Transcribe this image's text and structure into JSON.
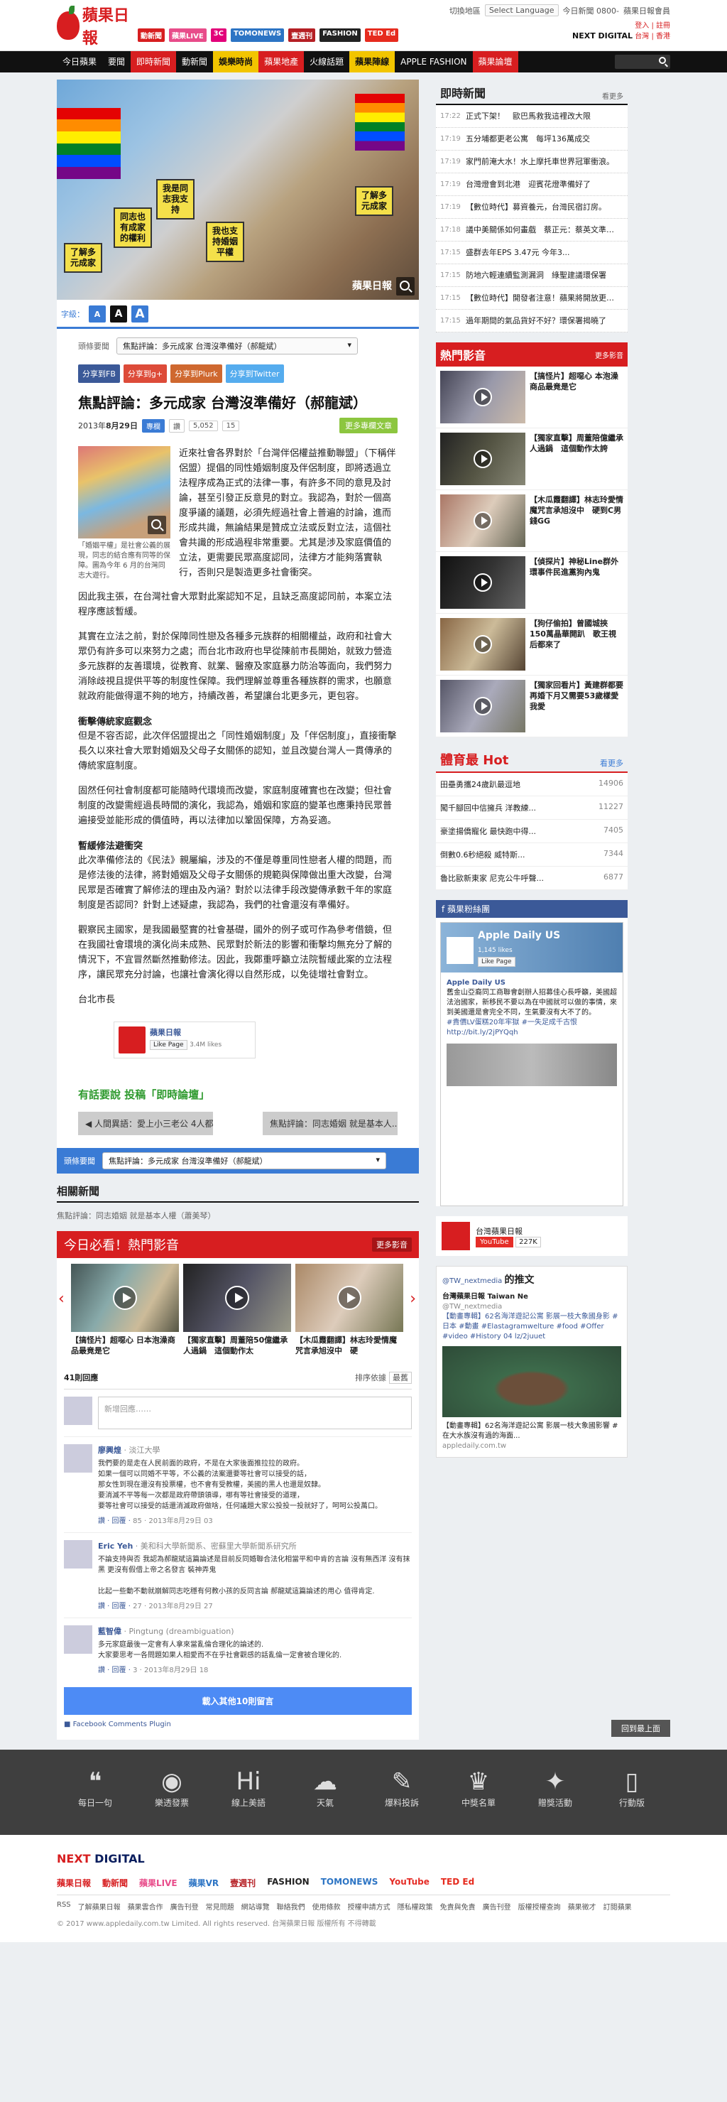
{
  "header": {
    "logo_text": "蘋果日報",
    "brands": [
      {
        "name": "動新聞",
        "color": "#d71e20"
      },
      {
        "name": "蘋果LIVE",
        "color": "#e84c8a"
      },
      {
        "name": "3C",
        "color": "#e2007a"
      },
      {
        "name": "TOMONEWS",
        "color": "#2c74c4"
      },
      {
        "name": "壹週刊",
        "color": "#b51f24"
      },
      {
        "name": "FASHION",
        "color": "#222"
      },
      {
        "name": "TED Ed",
        "color": "#e62b1e"
      }
    ],
    "util": {
      "location": "切換地區",
      "language": "Select Language",
      "phone": "今日新聞 0800-",
      "complaint": "蘋果日報會員",
      "login": "登入",
      "register": "註冊"
    },
    "nextdigital": "NEXT DIGITAL",
    "regions": "台灣 | 香港"
  },
  "nav": [
    {
      "label": "今日蘋果",
      "style": ""
    },
    {
      "label": "要聞",
      "style": ""
    },
    {
      "label": "即時新聞",
      "style": "hl"
    },
    {
      "label": "動新聞",
      "style": ""
    },
    {
      "label": "娛樂時尚",
      "style": "yel"
    },
    {
      "label": "蘋果地產",
      "style": "hl"
    },
    {
      "label": "火線話題",
      "style": ""
    },
    {
      "label": "蘋果陣線",
      "style": "yel"
    },
    {
      "label": "APPLE FASHION",
      "style": ""
    },
    {
      "label": "蘋果論壇",
      "style": "hl"
    }
  ],
  "hero": {
    "signs": [
      "了解多元成家",
      "我是同志我支持",
      "我也支持婚姻平權",
      "了解多元成家",
      "同志也有成家的權利"
    ],
    "watermark": "蘋果日報"
  },
  "fontbar": {
    "label": "字級：",
    "small": "A",
    "medium": "A",
    "large": "A"
  },
  "headnav": {
    "label": "頭條要聞",
    "current": "焦點評論：多元成家 台灣沒準備好（郝龍斌）"
  },
  "share": [
    {
      "label": "分享到FB",
      "color": "#3b5998"
    },
    {
      "label": "分享到g+",
      "color": "#dd4b39"
    },
    {
      "label": "分享到Plurk",
      "color": "#cf682f"
    },
    {
      "label": "分享到Twitter",
      "color": "#55acee"
    }
  ],
  "article": {
    "title": "焦點評論：多元成家 台灣沒準備好（郝龍斌）",
    "date": "2013年",
    "date_bold": "8月29日",
    "tags": [
      "專欄",
      "讚",
      "5,052",
      "15"
    ],
    "more_label": "更多專欄文章",
    "caption": "「婚姻平權」是社會公義的展現，同志的結合應有同等的保障。圖為今年 6 月的台灣同志大遊行。",
    "intro": "近來社會各界對於「台灣伴侶權益推動聯盟」（下稱伴侶盟）提倡的同性婚姻制度及伴侶制度，即將透過立法程序成為正式的法律一事，有許多不同的意見及討論，甚至引發正反意見的對立。我認為，對於一個高度爭議的議題，必須先經過社會上普遍的討論，進而形成共識，無論結果是贊成立法或反對立法，這個社會共識的形成過程非常重要。尤其是涉及家庭價值的立法，更需要民眾高度認同，法律方才能夠落實執行，否則只是製造更多社會衝突。",
    "paragraphs": [
      "因此我主張，在台灣社會大眾對此案認知不足，且缺乏高度認同前，本案立法程序應該暫緩。",
      "其實在立法之前，對於保障同性戀及各種多元族群的相關權益，政府和社會大眾仍有許多可以來努力之處；而台北市政府也早從陳前市長開始，就致力營造多元族群的友善環境，從教育、就業、醫療及家庭暴力防治等面向，我們努力消除歧視且提供平等的制度性保障。我們理解並尊重各種族群的需求，也願意就政府能做得還不夠的地方，持續改善，希望讓台北更多元，更包容。"
    ],
    "h1": "衝擊傳統家庭觀念",
    "paragraphs2": [
      "但是不容否認，此次伴侶盟提出之「同性婚姻制度」及「伴侶制度」，直接衝擊長久以來社會大眾對婚姻及父母子女關係的認知，並且改變台灣人一貫傳承的傳統家庭制度。",
      "固然任何社會制度都可能隨時代環境而改變，家庭制度確實也在改變；但社會制度的改變需經過長時間的演化，我認為，婚姻和家庭的變革也應秉持民眾普遍接受並能形成的價值時，再以法律加以鞏固保障，方為妥適。"
    ],
    "h2": "暫緩修法避衝突",
    "paragraphs3": [
      "此次準備修法的《民法》親屬編，涉及的不僅是尊重同性戀者人權的問題，而是修法後的法律，將對婚姻及父母子女關係的規範與保障做出重大改變，台灣民眾是否確實了解修法的理由及內涵？對於以法律手段改變傳承數千年的家庭制度是否認同？針對上述疑慮，我認為，我們的社會還沒有準備好。",
      "觀察民主國家，是我國最堅實的社會基礎，國外的例子或可作為參考借鏡，但在我國社會環境的演化尚未成熟、民眾對於新法的影響和衝擊均無充分了解的情況下，不宜冒然斷然推動修法。因此，我鄭重呼籲立法院暫緩此案的立法程序，讓民眾充分討論，也讓社會演化得以自然形成，以免徒增社會對立。"
    ],
    "signature": "台北市長",
    "fb": {
      "page": "蘋果日報",
      "like": "Like Page",
      "count": "3.4M likes"
    },
    "opinion_cta": "有話要說 投稿「即時論壇」",
    "prev": "人間異語：愛上小三老公 4人都...",
    "next": "焦點評論：同志婚姻 就是基本人..."
  },
  "bottomnav": {
    "label": "頭條要聞",
    "current": "焦點評論：多元成家 台灣沒準備好（郝龍斌）"
  },
  "related": {
    "title": "相關新聞",
    "items": [
      "焦點評論：同志婚姻 就是基本人權（蕭美琴）"
    ]
  },
  "hotvideo": {
    "title": "今日必看！熱門影音",
    "more": "更多影音",
    "items": [
      "【搞怪片】超噁心 日本泡澡商品最竟是它",
      "【獨家直擊】周董陪50億繼承人過鍋　這個動作太",
      "【木瓜霞翻譯】林志玲愛情魔咒言承旭沒中　硬"
    ]
  },
  "comments": {
    "count": "41則回應",
    "sort_label": "排序依據",
    "sort_value": "最舊",
    "placeholder": "新增回應……",
    "list": [
      {
        "name": "廖興煌",
        "school": "· 淡江大學",
        "text": "我們要的是走在人民前面的政府，不是在大家後面推拉拉的政府。\n如果一個可以同婚不平等，不公義的法案還要等社會可以接受的話，\n那女性到現在還沒有投票權，也不會有受教權，美國的黑人也還是奴隸。\n要消滅不平等每一次都是政府帶頭領導，哪有等社會接受的道理，\n要等社會可以接受的話還消滅政府做啥，任何議題大家公投投一投就好了，呵呵公投萬口。",
        "meta": "讚 · 回覆 · ",
        "likes": "85 · 2013年8月29日 03"
      },
      {
        "name": "Eric Yeh",
        "school": "· 美和科大學新聞系、密蘇里大學新聞系研究所",
        "text": "不論支持與否 我認為郝龍斌這篇論述是目前反同婚聯合法化相當平和中肯的言論 沒有無西洋 沒有抹黑 更沒有假借上帝之名發言 裝神弄鬼\n\n比起一些動不動就崩解同志吃穩有何教小孩的反同言論 郝龍斌這篇論述的用心 值得肯定.",
        "meta": "讚 · 回覆 · ",
        "likes": "27 · 2013年8月29日 27"
      },
      {
        "name": "藍智偉",
        "school": "· Pingtung (dreambiguation)",
        "text": "多元家庭最後一定會有人拿來當亂倫合理化的論述的.\n大家要思考一各問題如果人相愛而不在乎社會觀感的話亂倫一定會被合理化的.",
        "meta": "讚 · 回覆 · ",
        "likes": "3 · 2013年8月29日 18"
      }
    ],
    "load_more": "載入其他10則留言",
    "plugin": "Facebook Comments Plugin"
  },
  "right": {
    "instant_title": "即時新聞",
    "instant_more": "看更多",
    "instant": [
      {
        "time": "17:22",
        "text": "正式下架！　歐巴馬救我這裡改大限"
      },
      {
        "time": "17:19",
        "text": "五分埔都更老公寓　每坪136萬成交"
      },
      {
        "time": "17:19",
        "text": "家門前淹大水！水上摩托車世界冠軍衝浪。"
      },
      {
        "time": "17:19",
        "text": "台灣燈會到北港　迎賓花燈準備好了"
      },
      {
        "time": "17:19",
        "text": "【數位時代】募資養元，台灣民宿訂房。"
      },
      {
        "time": "17:18",
        "text": "議中美關係如何畫戲　蔡正元：蔡英文準…"
      },
      {
        "time": "17:15",
        "text": "盛群去年EPS 3.47元 今年3..."
      },
      {
        "time": "17:15",
        "text": "防地六輕連續監測漏洞　綠聖建議環保署"
      },
      {
        "time": "17:15",
        "text": "【數位時代】開發者注意！蘋果將開放更…"
      },
      {
        "time": "17:15",
        "text": "過年期間的氣品貨好不好？環保署揭曉了"
      }
    ],
    "hotvideo_title": "熱門影音",
    "hotvideo_more": "更多影音",
    "videos": [
      "【搞怪片】超噁心 本泡澡商品最竟是它",
      "【獨家直擊】周董陪億繼承人過鍋　這個動作太誇",
      "【木瓜霞翻譯】林志玲愛情魔咒言承旭沒中　硬到C男錢GG",
      "【偵探片】神秘Line群外環事件民進黨狗內鬼",
      "【狗仔偷拍】曾國城挾150萬晶華開趴　歌王視后都來了",
      "【獨家回看片】黃建群都要再婚下月又需要53歲樣愛我愛"
    ],
    "hot_title": "體育最 Hot",
    "hot_more": "看更多",
    "hot": [
      {
        "text": "田壘勇攜24歲趴最逗地",
        "count": "14906"
      },
      {
        "text": "闖千腳回中信擁兵 洋教練...",
        "count": "11227"
      },
      {
        "text": "豪塗揚僑寵化 最快跑中得...",
        "count": "7405"
      },
      {
        "text": "倒數0.6秒絕殺 威特斯...",
        "count": "7344"
      },
      {
        "text": "魯比歐新東家 尼克公牛呼聲...",
        "count": "6877"
      }
    ],
    "fb_title": "蘋果粉絲團",
    "fb_page": {
      "name": "Apple Daily US",
      "likes": "1,145 likes",
      "button": "Like Page",
      "poster": "Apple Daily US",
      "post": "舊金山亞裔同工商聯會創辦人招募佳心長呼籲，美國超法治國家，新移民不要以為在中國就可以做的事情，來到美國還是會完全不同，生氣要沒有大不了的。",
      "tags": "#貴價LV蛋糕20年牢獄 #一失足成千古恨",
      "link": "http://bit.ly/2jPYQqh"
    },
    "yt": {
      "name": "台灣蘋果日報",
      "button": "YouTube",
      "count": "227K"
    },
    "tw": {
      "handle": "@TW_nextmedia",
      "title": "的推文",
      "name": "台灣蘋果日報 Taiwan Ne",
      "user": "@TW_nextmedia",
      "text": "【動畫專輯】62名海洋遊記公寓 影展一枝大象國身影 #日本 #動畫 #Elastagramwelture #food #Offer #video #History 04 lz/2juuet",
      "caption": "【動畫專輯】62名海洋遊記公寓 影展一枝大象國影響 #在大水族沒有過的海面...",
      "src": "appledaily.com.tw"
    }
  },
  "scrolltop": "回到最上面",
  "footicons": [
    {
      "label": "每日一句",
      "glyph": "❝"
    },
    {
      "label": "樂透發票",
      "glyph": "◉"
    },
    {
      "label": "線上美語",
      "glyph": "Hi"
    },
    {
      "label": "天氣",
      "glyph": "☁"
    },
    {
      "label": "爆料投訴",
      "glyph": "✎"
    },
    {
      "label": "中獎名單",
      "glyph": "♛"
    },
    {
      "label": "贈獎活動",
      "glyph": "✦"
    },
    {
      "label": "行動版",
      "glyph": "▯"
    }
  ],
  "footer": {
    "logo_a": "NEXT",
    "logo_b": "DIGITAL",
    "brands": [
      "蘋果日報",
      "動新聞",
      "蘋果LIVE",
      "蘋果VR",
      "壹週刊",
      "FASHION",
      "TOMONEWS",
      "YouTube",
      "TED Ed"
    ],
    "links": [
      "RSS",
      "了解蘋果日報",
      "蘋果雲合作",
      "廣告刊登",
      "常見問題",
      "網站導覽",
      "聯絡我們",
      "使用條款",
      "授權申請方式",
      "隱私權政策",
      "免責與免責",
      "廣告刊登",
      "版權授權查詢",
      "蘋果徵才",
      "訂閱蘋果"
    ],
    "copyright": "© 2017 www.appledaily.com.tw Limited. All rights reserved. 台灣蘋果日報 版權所有 不得轉載"
  }
}
